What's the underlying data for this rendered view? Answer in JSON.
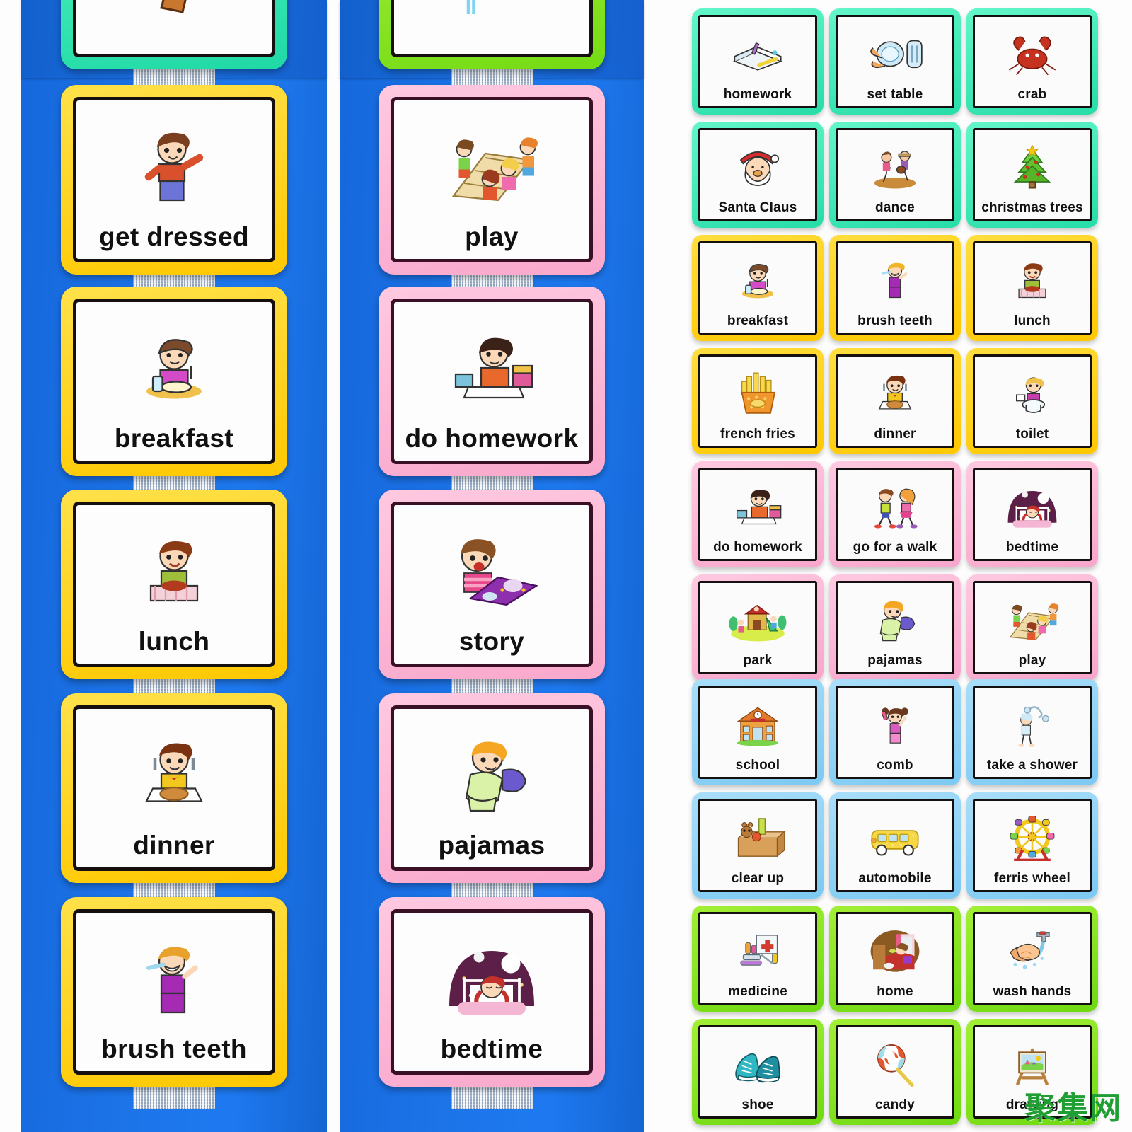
{
  "watermark": "聚集网",
  "boards": [
    {
      "name": "left-schedule-board",
      "cards": [
        {
          "label": "",
          "color": "teal",
          "icon": "chocolate-bar-icon",
          "partial": true
        },
        {
          "label": "get dressed",
          "color": "yellow",
          "icon": "boy-dressing-icon"
        },
        {
          "label": "breakfast",
          "color": "yellow",
          "icon": "girl-eating-breakfast-icon"
        },
        {
          "label": "lunch",
          "color": "yellow",
          "icon": "boy-eating-lunch-icon"
        },
        {
          "label": "dinner",
          "color": "yellow",
          "icon": "boy-eating-dinner-icon"
        },
        {
          "label": "brush teeth",
          "color": "yellow",
          "icon": "boy-brushing-teeth-icon"
        }
      ]
    },
    {
      "name": "middle-schedule-board",
      "cards": [
        {
          "label": "",
          "color": "green",
          "icon": "faucet-icon",
          "partial": true
        },
        {
          "label": "play",
          "color": "pink",
          "icon": "children-hopscotch-icon"
        },
        {
          "label": "do homework",
          "color": "pink",
          "icon": "girl-homework-icon"
        },
        {
          "label": "story",
          "color": "pink",
          "icon": "girl-reading-book-icon"
        },
        {
          "label": "pajamas",
          "color": "pink",
          "icon": "boy-pajamas-pillow-icon"
        },
        {
          "label": "bedtime",
          "color": "pink",
          "icon": "girl-in-bed-icon"
        }
      ]
    }
  ],
  "grid": {
    "columns": 3,
    "rows": 10,
    "cards": [
      {
        "label": "homework",
        "color": "teal",
        "icon": "open-book-pencil-icon"
      },
      {
        "label": "set table",
        "color": "teal",
        "icon": "plate-cutlery-icon"
      },
      {
        "label": "crab",
        "color": "teal",
        "icon": "crab-icon"
      },
      {
        "label": "Santa Claus",
        "color": "teal",
        "icon": "santa-face-icon"
      },
      {
        "label": "dance",
        "color": "teal",
        "icon": "dancing-couple-icon"
      },
      {
        "label": "christmas trees",
        "color": "teal",
        "icon": "christmas-tree-icon"
      },
      {
        "label": "breakfast",
        "color": "yellow",
        "icon": "girl-eating-breakfast-icon"
      },
      {
        "label": "brush teeth",
        "color": "yellow",
        "icon": "child-brushing-teeth-icon"
      },
      {
        "label": "lunch",
        "color": "yellow",
        "icon": "boy-eating-lunch-icon"
      },
      {
        "label": "french fries",
        "color": "yellow",
        "icon": "french-fries-icon"
      },
      {
        "label": "dinner",
        "color": "yellow",
        "icon": "boy-eating-dinner-icon"
      },
      {
        "label": "toilet",
        "color": "yellow",
        "icon": "girl-on-toilet-icon"
      },
      {
        "label": "do homework",
        "color": "pink",
        "icon": "girl-homework-icon"
      },
      {
        "label": "go for a walk",
        "color": "pink",
        "icon": "two-children-walking-icon"
      },
      {
        "label": "bedtime",
        "color": "pink",
        "icon": "girl-in-bed-icon"
      },
      {
        "label": "park",
        "color": "pink",
        "icon": "playground-icon"
      },
      {
        "label": "pajamas",
        "color": "pink",
        "icon": "boy-pajamas-pillow-icon"
      },
      {
        "label": "play",
        "color": "pink",
        "icon": "children-hopscotch-icon"
      },
      {
        "label": "school",
        "color": "blue",
        "icon": "school-building-icon"
      },
      {
        "label": "comb",
        "color": "blue",
        "icon": "girl-combing-hair-icon"
      },
      {
        "label": "take a shower",
        "color": "blue",
        "icon": "person-shower-icon"
      },
      {
        "label": "clear up",
        "color": "blue",
        "icon": "toy-box-icon"
      },
      {
        "label": "automobile",
        "color": "blue",
        "icon": "school-bus-icon"
      },
      {
        "label": "ferris wheel",
        "color": "blue",
        "icon": "ferris-wheel-icon"
      },
      {
        "label": "medicine",
        "color": "green",
        "icon": "medicine-kit-icon"
      },
      {
        "label": "home",
        "color": "green",
        "icon": "living-room-icon"
      },
      {
        "label": "wash hands",
        "color": "green",
        "icon": "washing-hands-icon"
      },
      {
        "label": "shoe",
        "color": "green",
        "icon": "sneakers-icon"
      },
      {
        "label": "candy",
        "color": "green",
        "icon": "lollipop-icon"
      },
      {
        "label": "drawing",
        "color": "green",
        "icon": "easel-painting-icon"
      }
    ]
  },
  "colors": {
    "board_blue": "#1C74E8",
    "teal": "#2FE8AE",
    "yellow": "#FFD400",
    "pink": "#FBBAD8",
    "light_blue": "#8FD4F5",
    "green": "#7EE617",
    "card_border": "#15100f",
    "watermark_green": "#1f9e33"
  }
}
